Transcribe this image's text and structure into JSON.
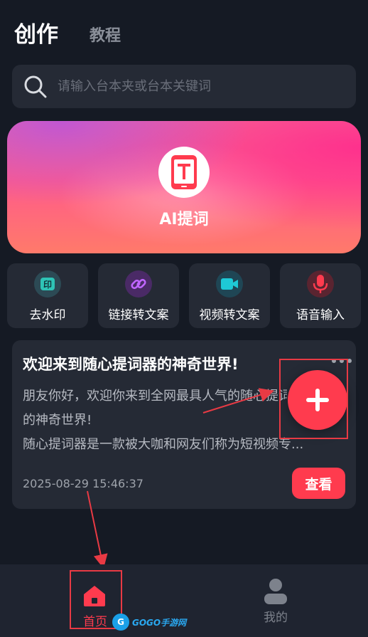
{
  "header": {
    "tabs": [
      {
        "label": "创作",
        "active": true
      },
      {
        "label": "教程",
        "active": false
      }
    ]
  },
  "search": {
    "placeholder": "请输入台本夹或台本关键词",
    "icon": "search-icon"
  },
  "banner": {
    "label": "AI提词",
    "icon": "phone-teleprompter-icon"
  },
  "tools": [
    {
      "label": "去水印",
      "icon": "watermark-remove-icon",
      "color": "#2ec4b6"
    },
    {
      "label": "链接转文案",
      "icon": "link-icon",
      "color": "#b14ae8"
    },
    {
      "label": "视频转文案",
      "icon": "video-camera-icon",
      "color": "#1ec9d6"
    },
    {
      "label": "语音输入",
      "icon": "microphone-icon",
      "color": "#ff3b4e"
    }
  ],
  "card": {
    "title": "欢迎来到随心提词器的神奇世界!",
    "body_line1": "朋友你好，欢迎你来到全网最具人气的随心提词器",
    "body_line2": "的神奇世界!",
    "body_line3": "随心提词器是一款被大咖和网友们称为短视频专...",
    "time": "2025-08-29 15:46:37",
    "view_label": "查看",
    "more_icon": "more-dots-icon"
  },
  "fab": {
    "icon": "plus-icon"
  },
  "bottom_nav": {
    "items": [
      {
        "label": "首页",
        "icon": "home-icon",
        "active": true
      },
      {
        "label": "我的",
        "icon": "user-icon",
        "active": false
      }
    ]
  },
  "watermark": {
    "logo": "G",
    "text": "GOGO手游网"
  },
  "colors": {
    "accent": "#ff3b4e",
    "background": "#151a24",
    "card": "#252a35",
    "annotation": "#e83a44"
  }
}
